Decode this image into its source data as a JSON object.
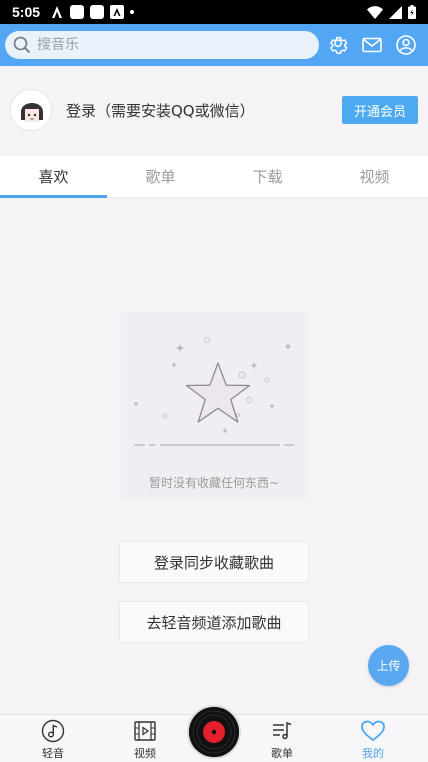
{
  "status_bar": {
    "time": "5:05"
  },
  "search": {
    "placeholder": "搜音乐"
  },
  "user": {
    "login_text": "登录（需要安装QQ或微信）",
    "vip_button": "开通会员"
  },
  "tabs": [
    {
      "label": "喜欢",
      "active": true
    },
    {
      "label": "歌单",
      "active": false
    },
    {
      "label": "下载",
      "active": false
    },
    {
      "label": "视频",
      "active": false
    }
  ],
  "empty_state": {
    "text": "暂时没有收藏任何东西~"
  },
  "actions": {
    "login_sync": "登录同步收藏歌曲",
    "add_songs": "去轻音频道添加歌曲"
  },
  "upload_button": "上传",
  "bottom_nav": [
    {
      "label": "轻音",
      "icon": "music-note-icon"
    },
    {
      "label": "视频",
      "icon": "film-icon"
    },
    {
      "label": "",
      "icon": "vinyl-record-icon"
    },
    {
      "label": "歌单",
      "icon": "playlist-icon"
    },
    {
      "label": "我的",
      "icon": "heart-icon",
      "active": true
    }
  ],
  "colors": {
    "primary": "#53a6f3",
    "accent": "#4ea4ea",
    "record_red": "#e5202e"
  }
}
